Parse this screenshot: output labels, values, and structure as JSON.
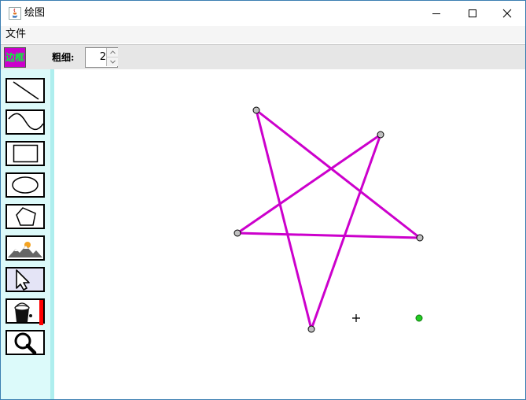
{
  "window": {
    "title": "绘图",
    "controls": [
      "minimize-icon",
      "maximize-icon",
      "close-icon"
    ]
  },
  "menu": {
    "items": [
      {
        "label": "文件"
      }
    ]
  },
  "toolbar": {
    "border_toggle_label": "边框",
    "border_toggle_colors": {
      "background": "#cc00cc",
      "text": "#00ff33"
    },
    "thickness_label": "粗细:",
    "thickness_value": "2"
  },
  "tools": [
    {
      "name": "line-tool",
      "icon": "line-icon"
    },
    {
      "name": "curve-tool",
      "icon": "curve-icon"
    },
    {
      "name": "rectangle-tool",
      "icon": "rectangle-icon"
    },
    {
      "name": "ellipse-tool",
      "icon": "ellipse-icon"
    },
    {
      "name": "polygon-tool",
      "icon": "pentagon-icon"
    },
    {
      "name": "image-tool",
      "icon": "landscape-icon"
    },
    {
      "name": "select-tool",
      "icon": "arrow-cursor-icon",
      "selected": true
    },
    {
      "name": "fill-tool",
      "icon": "paint-bucket-icon",
      "color": "#ff0000"
    },
    {
      "name": "zoom-tool",
      "icon": "magnifier-icon"
    }
  ],
  "canvas": {
    "shape_color": "#cc00cc",
    "handle_color": "#c0c0c0",
    "extra_point_color": "#22cc22"
  }
}
